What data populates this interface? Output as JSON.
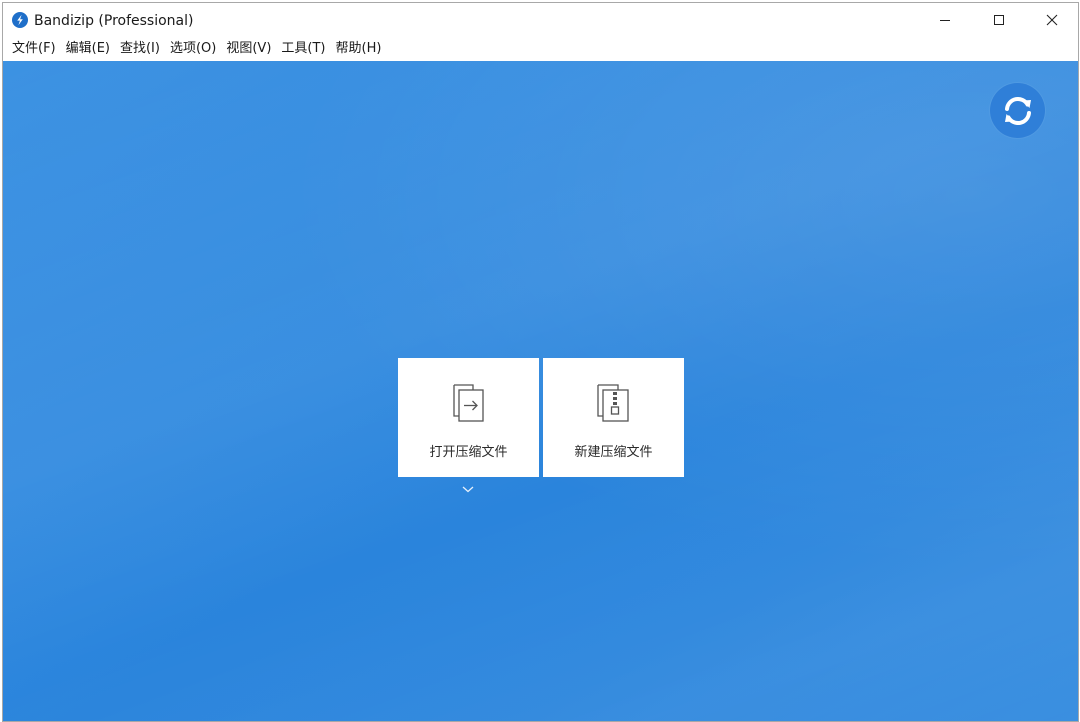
{
  "window": {
    "title": "Bandizip (Professional)"
  },
  "menu": [
    {
      "label": "文件(F)"
    },
    {
      "label": "编辑(E)"
    },
    {
      "label": "查找(I)"
    },
    {
      "label": "选项(O)"
    },
    {
      "label": "视图(V)"
    },
    {
      "label": "工具(T)"
    },
    {
      "label": "帮助(H)"
    }
  ],
  "actions": {
    "open_label": "打开压缩文件",
    "new_label": "新建压缩文件"
  },
  "icons": {
    "app": "bandizip-logo-icon",
    "minimize": "minimize-icon",
    "maximize": "maximize-icon",
    "close": "close-icon",
    "refresh": "refresh-icon",
    "open": "open-archive-icon",
    "new": "new-archive-icon",
    "dropdown": "chevron-down-icon"
  },
  "colors": {
    "background_blue": "#2f89df",
    "refresh_button": "#2f7fd8",
    "tile": "#ffffff"
  }
}
